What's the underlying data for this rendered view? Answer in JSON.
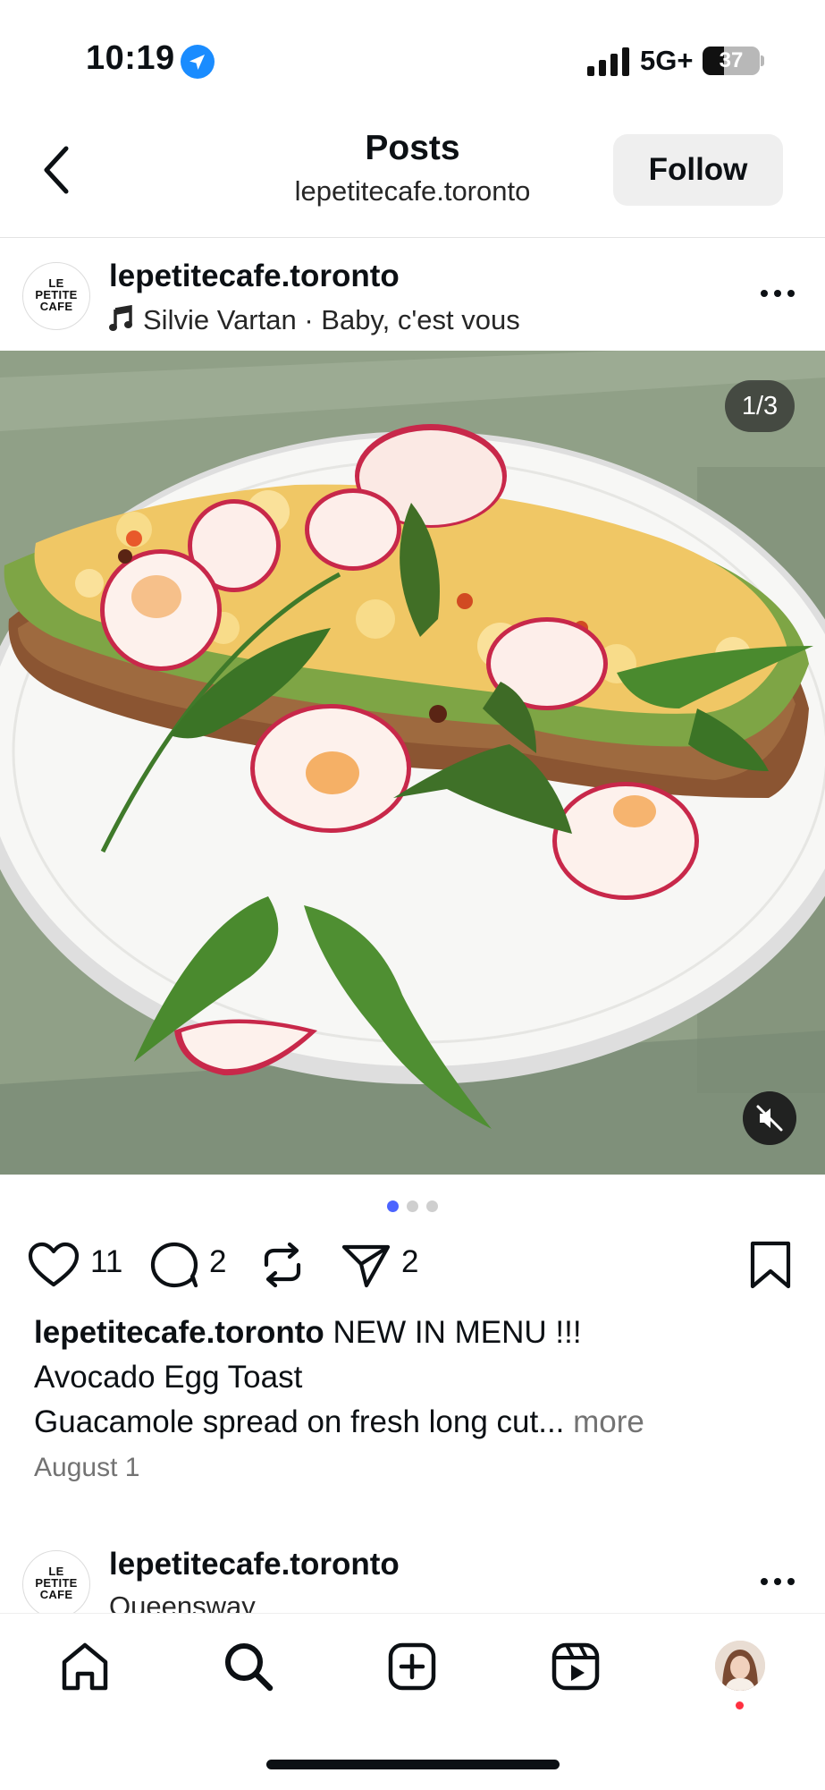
{
  "status": {
    "time": "10:19",
    "network": "5G+",
    "battery": "37",
    "battery_level": 0.37
  },
  "header": {
    "title": "Posts",
    "subtitle": "lepetitecafe.toronto",
    "follow_label": "Follow"
  },
  "brand_logo": [
    "LE",
    "PETITE",
    "CAFE"
  ],
  "post": {
    "username": "lepetitecafe.toronto",
    "music": "Silvie Vartan · Baby, c'est vous",
    "photo_counter": "1/3",
    "carousel": {
      "total": 3,
      "active": 0
    },
    "likes": "11",
    "comments": "2",
    "shares": "2",
    "caption_title": "NEW IN MENU !!!",
    "caption_line2": "Avocado Egg Toast",
    "caption_line3": "Guacamole spread on fresh long cut...",
    "more": "more",
    "date": "August 1"
  },
  "next_post": {
    "username": "lepetitecafe.toronto",
    "location": "Queensway"
  },
  "icons": {
    "status": [
      "location-arrow-icon",
      "cellular-signal-icon",
      "battery-icon"
    ],
    "header": [
      "back-chevron-icon"
    ],
    "post": [
      "music-note-icon",
      "more-options-icon",
      "mute-icon"
    ],
    "actions": [
      "heart-icon",
      "comment-icon",
      "repost-icon",
      "share-icon",
      "bookmark-icon"
    ],
    "nav": [
      "home-icon",
      "search-icon",
      "create-icon",
      "reels-icon",
      "profile-avatar"
    ]
  },
  "colors": {
    "accent_blue": "#4c64ff",
    "follow_bg": "#efefef",
    "muted_text": "#737373",
    "notification": "#ff3040"
  }
}
